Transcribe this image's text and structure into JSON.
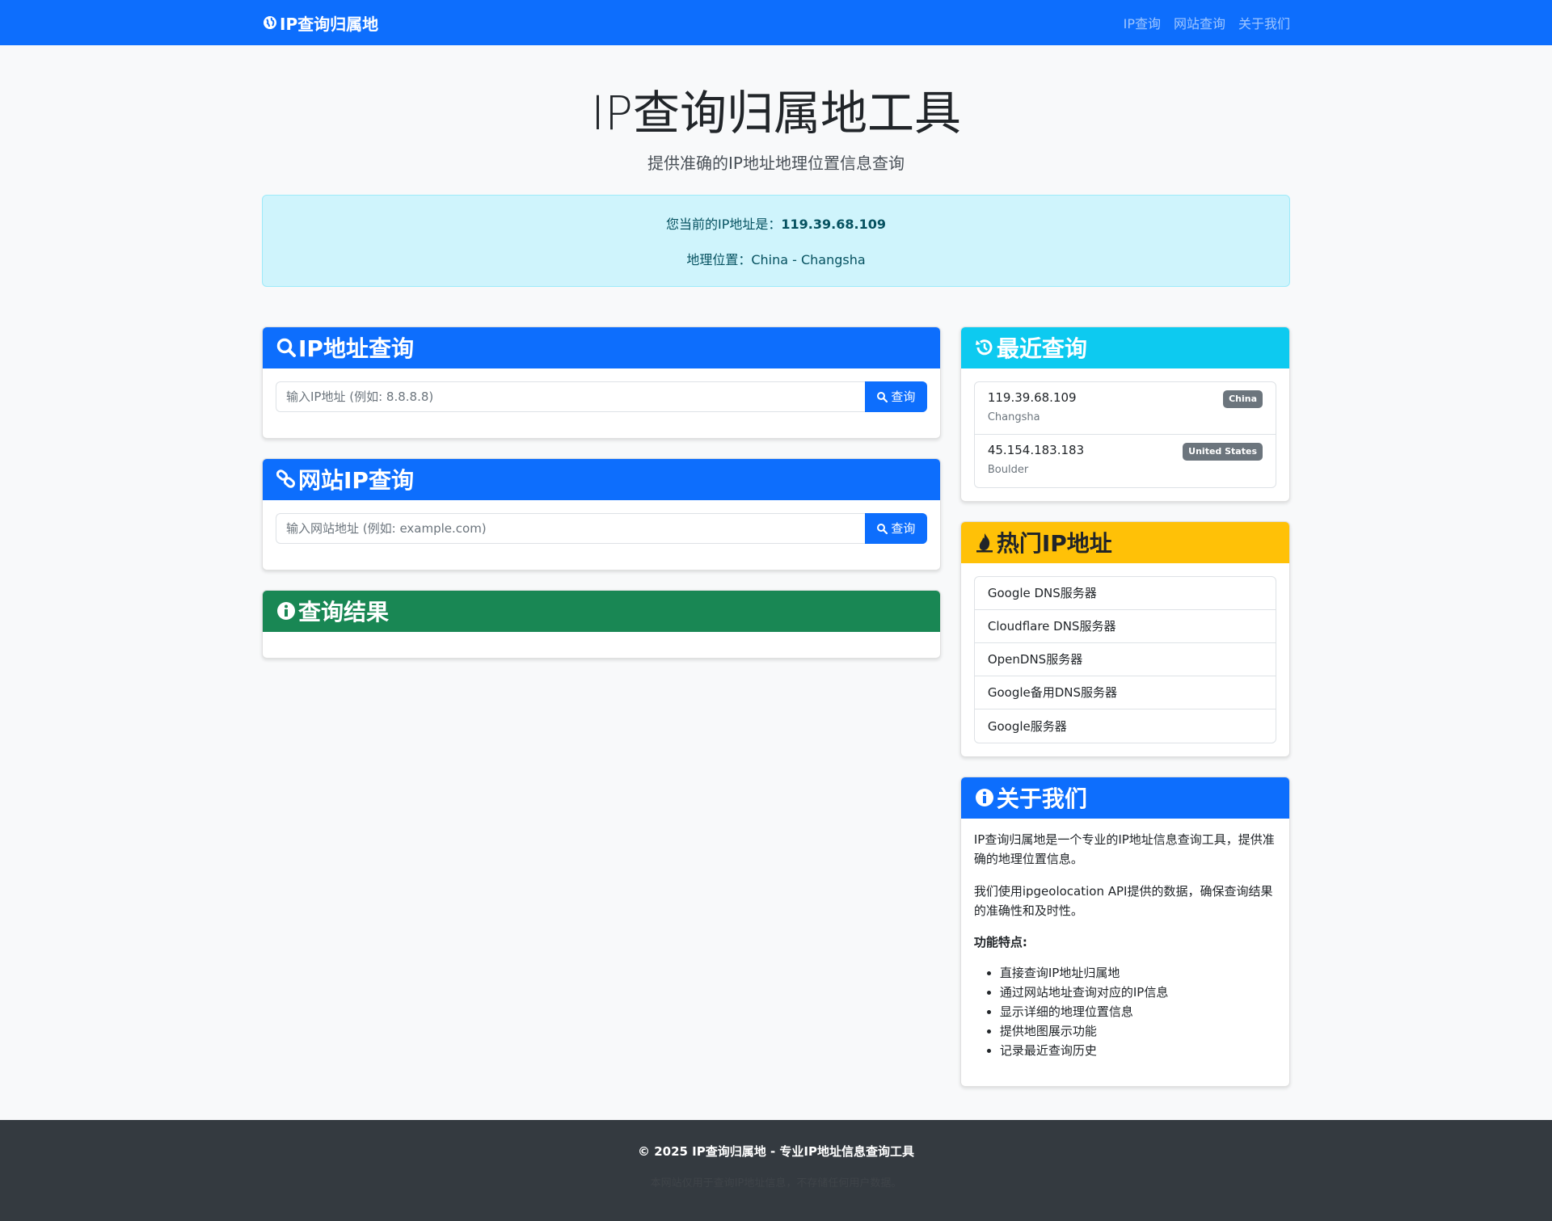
{
  "navbar": {
    "brand": "IP查询归属地",
    "links": [
      "IP查询",
      "网站查询",
      "关于我们"
    ]
  },
  "hero": {
    "title": "IP查询归属地工具",
    "subtitle": "提供准确的IP地址地理位置信息查询"
  },
  "current_ip": {
    "label": "您当前的IP地址是：",
    "ip": "119.39.68.109",
    "location_label": "地理位置：",
    "location": "China - Changsha"
  },
  "ip_query": {
    "title": "IP地址查询",
    "placeholder": "输入IP地址 (例如: 8.8.8.8)",
    "button": "查询"
  },
  "site_query": {
    "title": "网站IP查询",
    "placeholder": "输入网站地址 (例如: example.com)",
    "button": "查询"
  },
  "result": {
    "title": "查询结果"
  },
  "recent": {
    "title": "最近查询",
    "items": [
      {
        "ip": "119.39.68.109",
        "city": "Changsha",
        "country": "China"
      },
      {
        "ip": "45.154.183.183",
        "city": "Boulder",
        "country": "United States"
      }
    ]
  },
  "hot": {
    "title": "热门IP地址",
    "items": [
      "Google DNS服务器",
      "Cloudflare DNS服务器",
      "OpenDNS服务器",
      "Google备用DNS服务器",
      "Google服务器"
    ]
  },
  "about": {
    "title": "关于我们",
    "p1": "IP查询归属地是一个专业的IP地址信息查询工具，提供准确的地理位置信息。",
    "p2": "我们使用ipgeolocation API提供的数据，确保查询结果的准确性和及时性。",
    "features_title": "功能特点:",
    "features": [
      "直接查询IP地址归属地",
      "通过网站地址查询对应的IP信息",
      "显示详细的地理位置信息",
      "提供地图展示功能",
      "记录最近查询历史"
    ]
  },
  "footer": {
    "line1": "© 2025 IP查询归属地 - 专业IP地址信息查询工具",
    "line2": "本网站仅用于查询IP地址信息，不存储任何用户数据。"
  }
}
